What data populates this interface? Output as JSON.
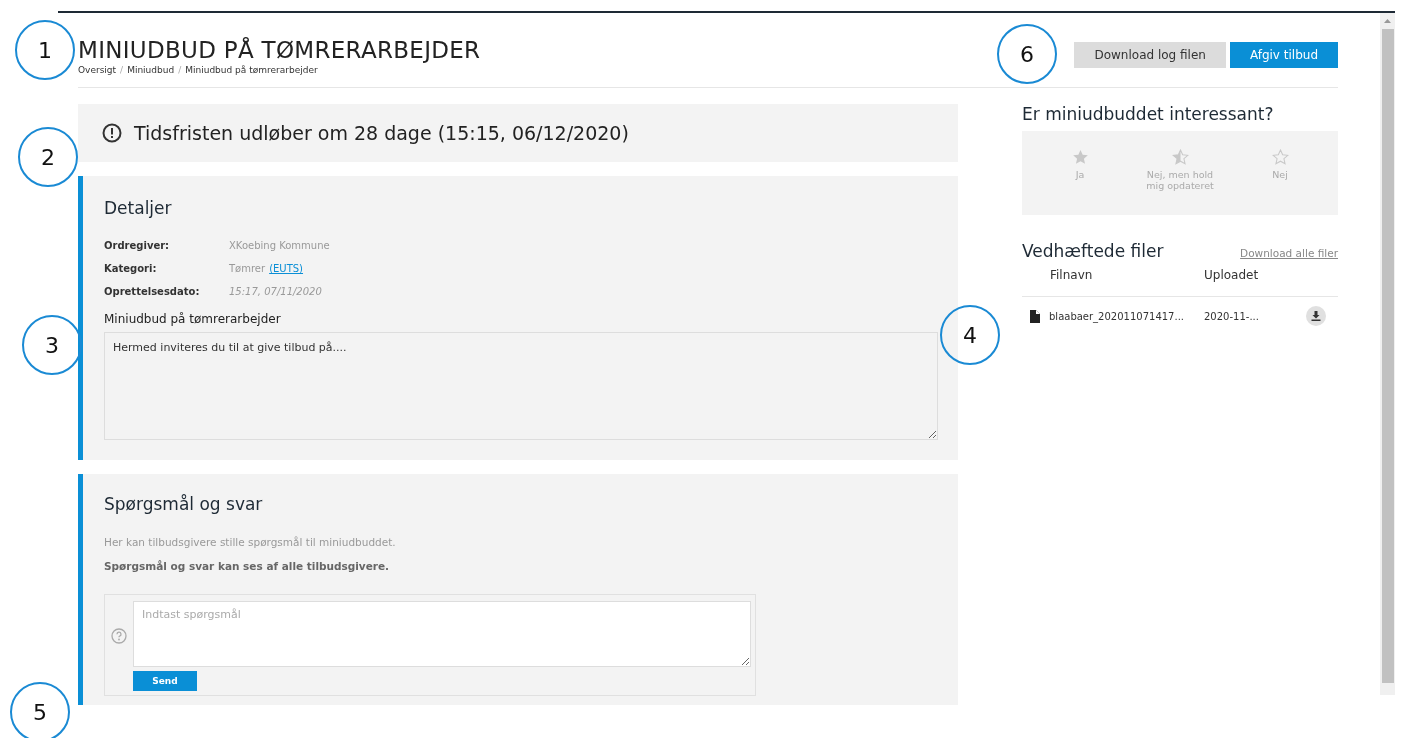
{
  "header": {
    "title": "MINIUDBUD PÅ TØMRERARBEJDER",
    "breadcrumb": [
      "Oversigt",
      "Miniudbud",
      "Miniudbud på tømrerarbejder"
    ],
    "breadcrumb_separator": "/",
    "buttons": [
      {
        "label": "Download log filen",
        "kind": "secondary"
      },
      {
        "label": "Afgiv tilbud",
        "kind": "primary"
      }
    ]
  },
  "deadline": {
    "text": "Tidsfristen udløber om 28 dage (15:15, 06/12/2020)"
  },
  "details": {
    "heading": "Detaljer",
    "rows": [
      {
        "label": "Ordregiver:",
        "value": "XKoebing Kommune",
        "kind": "plain"
      },
      {
        "label": "Kategori:",
        "value": "Tømrer",
        "link": "(EUTS)",
        "kind": "plain"
      },
      {
        "label": "Oprettelsesdato:",
        "value": "15:17, 07/11/2020",
        "kind": "italic"
      }
    ],
    "description_label": "Miniudbud på tømrerarbejder",
    "description": "Hermed inviteres du til at give tilbud på...."
  },
  "questions": {
    "heading": "Spørgsmål og svar",
    "lines": [
      "Her kan tilbudsgivere stille spørgsmål til miniudbuddet.",
      "Spørgsmål og svar kan ses af alle tilbudsgivere."
    ],
    "placeholder": "Indtast spørgsmål",
    "button": "Send"
  },
  "interest": {
    "heading": "Er miniudbuddet interessant?",
    "options": [
      {
        "label": "Ja",
        "kind": "filled",
        "selected": false
      },
      {
        "label": "Nej, men hold mig opdateret",
        "kind": "half",
        "selected": false
      },
      {
        "label": "Nej",
        "kind": "empty",
        "selected": false
      }
    ]
  },
  "attachments": {
    "heading": "Vedhæftede filer",
    "download_all": "Download alle filer",
    "columns": [
      "Filnavn",
      "Uploadet"
    ],
    "rows": [
      {
        "name": "blaabaer_202011071417...",
        "uploaded": "2020-11-..."
      }
    ]
  },
  "callouts": [
    "1",
    "2",
    "3",
    "4",
    "5",
    "6"
  ]
}
